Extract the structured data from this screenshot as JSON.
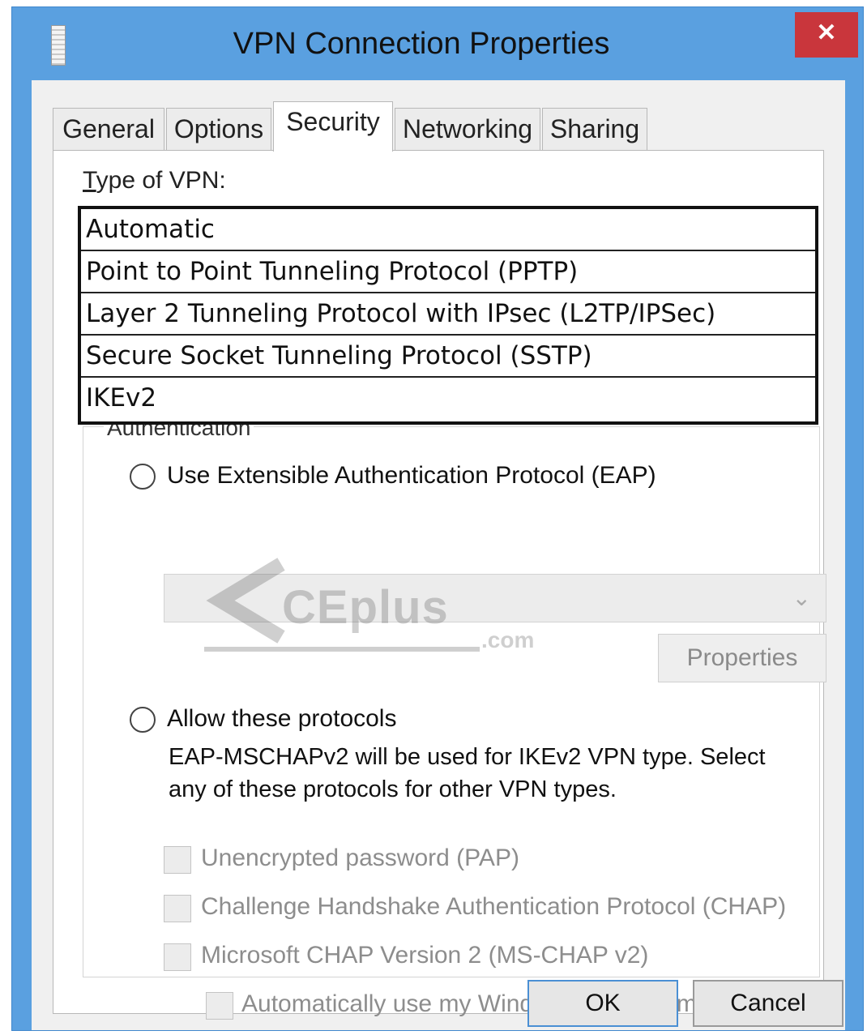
{
  "window": {
    "title": "VPN Connection Properties",
    "close_symbol": "✕"
  },
  "tabs": [
    {
      "label": "General"
    },
    {
      "label": "Options"
    },
    {
      "label": "Security"
    },
    {
      "label": "Networking"
    },
    {
      "label": "Sharing"
    }
  ],
  "active_tab": "Security",
  "vpn_type": {
    "label_first": "T",
    "label_rest": "ype of VPN:",
    "options": [
      "Automatic",
      "Point to Point Tunneling Protocol (PPTP)",
      "Layer 2 Tunneling Protocol with IPsec (L2TP/IPSec)",
      "Secure Socket Tunneling Protocol (SSTP)",
      "IKEv2"
    ]
  },
  "authentication": {
    "legend": "Authentication",
    "eap_label": "Use Extensible Authentication Protocol (EAP)",
    "eap_combo_value": "",
    "properties_button": "Properties",
    "allow_label": "Allow these protocols",
    "description": "EAP-MSCHAPv2 will be used for IKEv2 VPN type. Select any of these protocols for other VPN types.",
    "protocols": [
      "Unencrypted password (PAP)",
      "Challenge Handshake Authentication Protocol (CHAP)",
      "Microsoft CHAP Version 2 (MS-CHAP v2)"
    ],
    "sub_option": "Automatically use my Windows logon name and"
  },
  "buttons": {
    "ok": "OK",
    "cancel": "Cancel"
  },
  "watermark": {
    "text": "CEplus",
    "suffix": ".com"
  },
  "colors": {
    "titlebar": "#5aa0e0",
    "close": "#c9363c",
    "dialog_bg": "#f0f0f0"
  }
}
